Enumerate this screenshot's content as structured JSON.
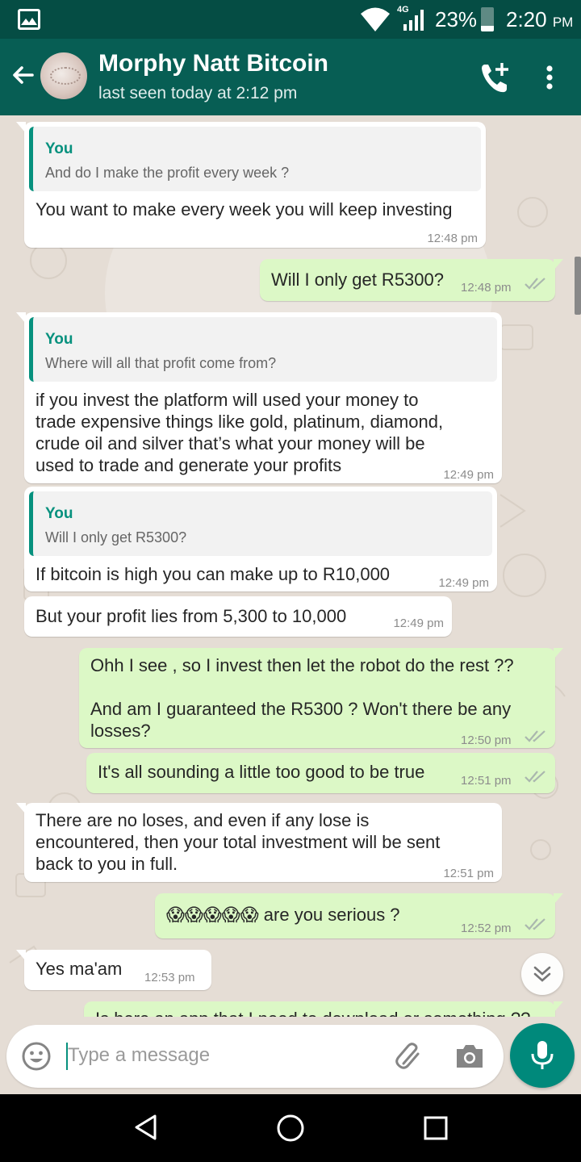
{
  "status_bar": {
    "network": "4G",
    "battery_percent": "23%",
    "battery_level": 0.23,
    "time": "2:20",
    "time_suffix": "PM"
  },
  "header": {
    "contact_name": "Morphy Natt Bitcoin",
    "last_seen": "last seen today at 2:12 pm"
  },
  "messages": [
    {
      "direction": "in",
      "quote_author": "You",
      "quote_text": "And do I make the profit every week ?",
      "text": "You want to make every week you will keep investing",
      "time": "12:48 pm"
    },
    {
      "direction": "out",
      "text": "Will I only get R5300?",
      "time": "12:48 pm",
      "status": "read"
    },
    {
      "direction": "in",
      "quote_author": "You",
      "quote_text": "Where will all that profit come from?",
      "text": "if you invest the platform will used your money to\ntrade expensive things like gold, platinum, diamond,\ncrude oil and silver that’s what your money will be\nused to trade and generate your profits",
      "time": "12:49 pm"
    },
    {
      "direction": "in",
      "quote_author": "You",
      "quote_text": "Will I only get R5300?",
      "text": "If bitcoin is high you can make up to R10,000",
      "time": "12:49 pm"
    },
    {
      "direction": "in",
      "text": "But your profit lies from 5,300 to 10,000",
      "time": "12:49 pm"
    },
    {
      "direction": "out",
      "text": "Ohh I see , so I invest then let the robot do the rest ??\n\nAnd am I guaranteed the R5300 ? Won't there be any\nlosses?",
      "time": "12:50 pm",
      "status": "read"
    },
    {
      "direction": "out",
      "text": "It's all sounding a little too good to be true",
      "time": "12:51 pm",
      "status": "read"
    },
    {
      "direction": "in",
      "text": "There are no loses, and even if any lose is\nencountered, then your total investment will be sent\nback to you in full.",
      "time": "12:51 pm"
    },
    {
      "direction": "out",
      "text": "😱😱😱😱😱 are you serious ?",
      "time": "12:52 pm",
      "status": "read"
    },
    {
      "direction": "in",
      "text": "Yes ma'am",
      "time": "12:53 pm"
    },
    {
      "direction": "out",
      "text": "Is here an app that I need to download or something ??",
      "time": "",
      "status": "partial"
    }
  ],
  "composer": {
    "placeholder": "Type a message"
  },
  "colors": {
    "header": "#075e54",
    "status_bar": "#054d44",
    "accent": "#07917e",
    "outgoing_bubble": "#dcf8c6",
    "incoming_bubble": "#ffffff",
    "chat_background": "#e5ddd5",
    "read_ticks": "#4fc3f7"
  },
  "icons": [
    "image-icon",
    "wifi-icon",
    "signal-icon",
    "battery-icon",
    "back-arrow-icon",
    "add-call-icon",
    "more-vert-icon",
    "double-check-icon",
    "scroll-down-icon",
    "emoji-icon",
    "attach-icon",
    "camera-icon",
    "mic-icon",
    "nav-back-icon",
    "nav-home-icon",
    "nav-recents-icon"
  ]
}
